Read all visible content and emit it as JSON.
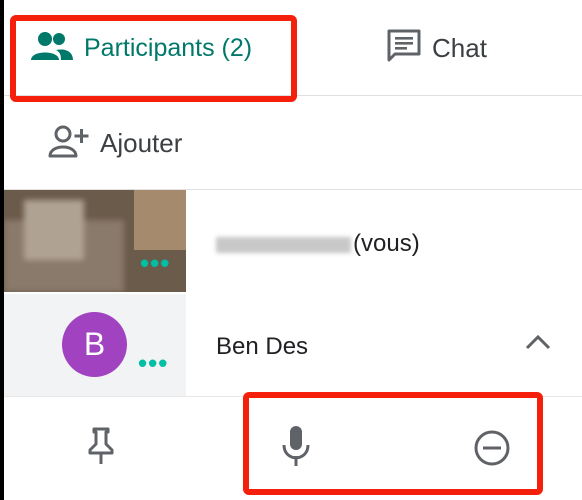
{
  "tabs": {
    "participants_label": "Participants (2)",
    "chat_label": "Chat"
  },
  "add": {
    "label": "Ajouter"
  },
  "participants": [
    {
      "name_suffix": "(vous)",
      "avatar": ""
    },
    {
      "name": "Ben Des",
      "avatar": "B"
    }
  ],
  "icons": {
    "participants": "people-icon",
    "chat": "chat-icon",
    "add": "person-add-icon",
    "more": "more-dots-icon",
    "expand": "chevron-up-icon",
    "pin": "pin-icon",
    "mic": "microphone-icon",
    "remove": "remove-circle-icon"
  },
  "colors": {
    "accent": "#00796b",
    "dots": "#00bfa5",
    "avatar_b": "#a142c0",
    "highlight": "#f4200c"
  }
}
